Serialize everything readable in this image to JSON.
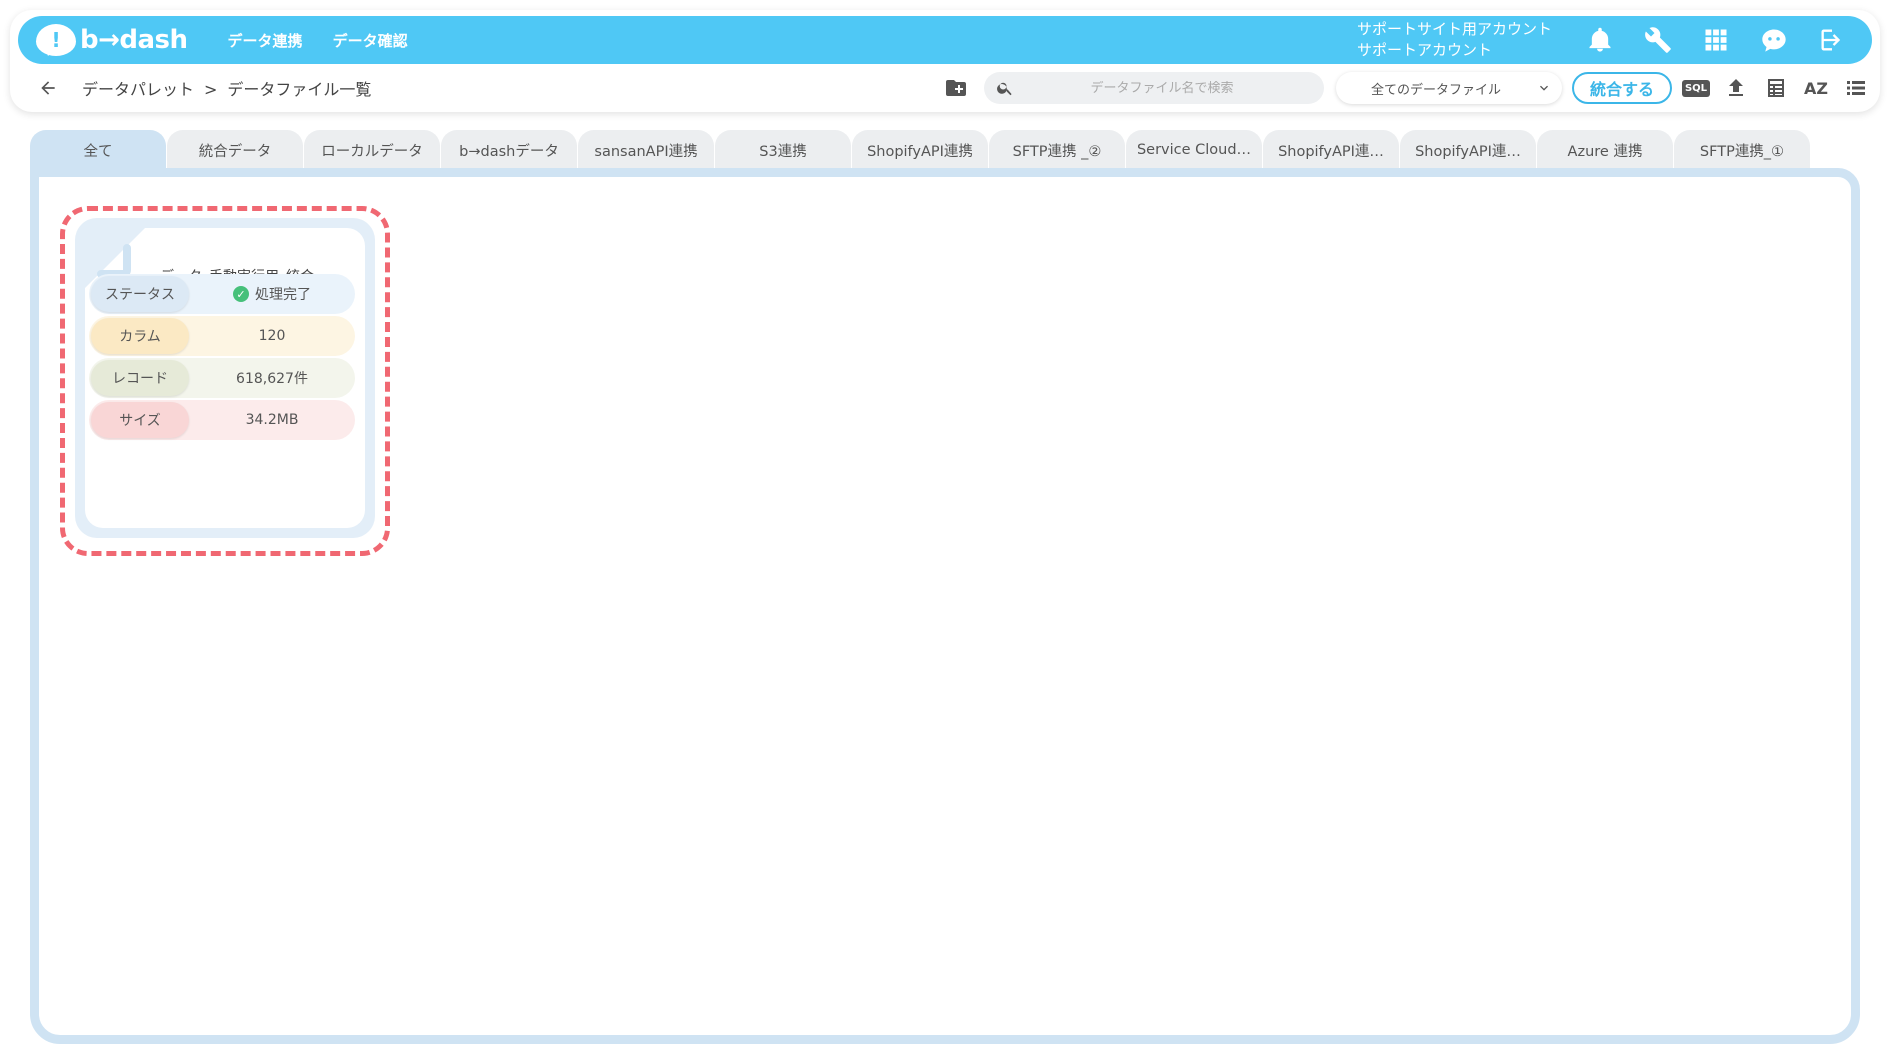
{
  "header": {
    "logo_text": "b→dash",
    "nav": [
      "データ連携",
      "データ確認"
    ],
    "account_line1": "サポートサイト用アカウント",
    "account_line2": "サポートアカウント",
    "icons": [
      "bell-icon",
      "wrench-icon",
      "apps-grid-icon",
      "chat-bot-icon",
      "logout-icon"
    ]
  },
  "toolbar": {
    "breadcrumb_root": "データパレット",
    "breadcrumb_sep": ">",
    "breadcrumb_current": "データファイル一覧",
    "search_placeholder": "データファイル名で検索",
    "filter_value": "全てのデータファイル",
    "merge_label": "統合する",
    "sql_label": "SQL",
    "az_label": "AZ"
  },
  "tabs": [
    "全て",
    "統合データ",
    "ローカルデータ",
    "b→dashデータ",
    "sansanAPI連携",
    "S3連携",
    "ShopifyAPI連携",
    "SFTP連携 _②",
    "Service Cloud…",
    "ShopifyAPI連…",
    "ShopifyAPI連…",
    "Azure 連携",
    "SFTP連携_①"
  ],
  "active_tab": 0,
  "card": {
    "title": "データ_手動実行用_統合",
    "rows": [
      {
        "label": "ステータス",
        "value": "処理完了",
        "label_color": "#dce9f5",
        "value_color": "#eaf3fb"
      },
      {
        "label": "カラム",
        "value": "120",
        "label_color": "#fbe9c4",
        "value_color": "#fdf5e3"
      },
      {
        "label": "レコード",
        "value": "618,627件",
        "label_color": "#e6ead8",
        "value_color": "#f3f5ec"
      },
      {
        "label": "サイズ",
        "value": "34.2MB",
        "label_color": "#f9d6d6",
        "value_color": "#fcebeb"
      }
    ]
  },
  "colors": {
    "header_bg": "#4fc8f5",
    "highlight_outline": "#f06872",
    "status_ok": "#46c07a"
  }
}
